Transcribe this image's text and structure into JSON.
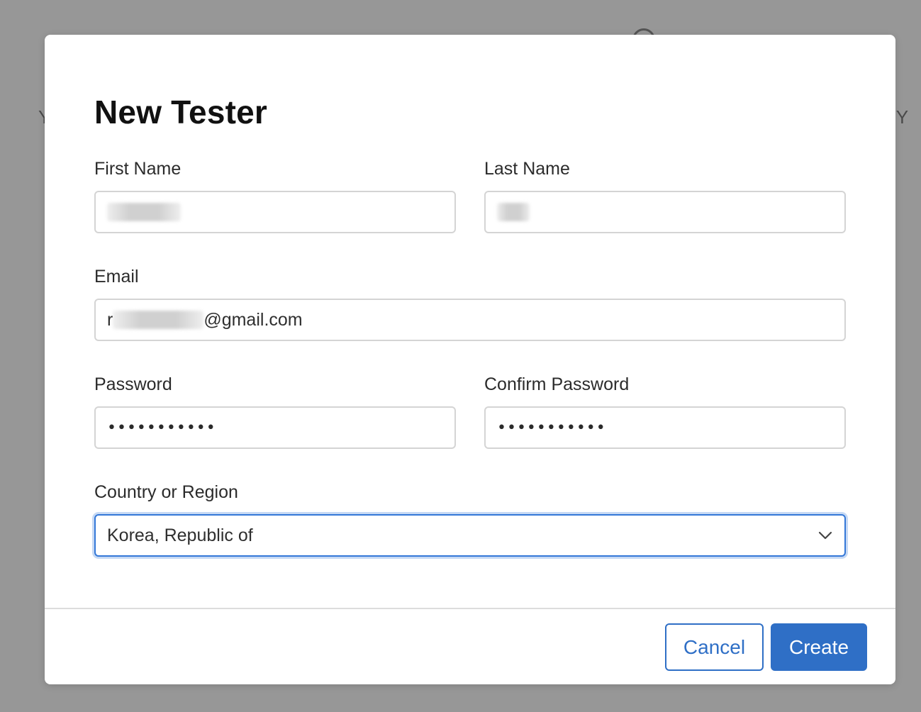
{
  "background": {
    "left_hint": "Y",
    "right_hint": "l. Y"
  },
  "dialog": {
    "title": "New Tester",
    "fields": {
      "first_name": {
        "label": "First Name",
        "value": ""
      },
      "last_name": {
        "label": "Last Name",
        "value": ""
      },
      "email": {
        "label": "Email",
        "value_prefix": "r",
        "value_suffix": "@gmail.com"
      },
      "password": {
        "label": "Password",
        "value": "•••••••••••"
      },
      "confirm_password": {
        "label": "Confirm Password",
        "value": "•••••••••••"
      },
      "country": {
        "label": "Country or Region",
        "value": "Korea, Republic of"
      }
    },
    "buttons": {
      "cancel": "Cancel",
      "create": "Create"
    }
  },
  "colors": {
    "accent": "#2f6fc6",
    "focus_ring": "#3478d8",
    "overlay": "#979797"
  }
}
